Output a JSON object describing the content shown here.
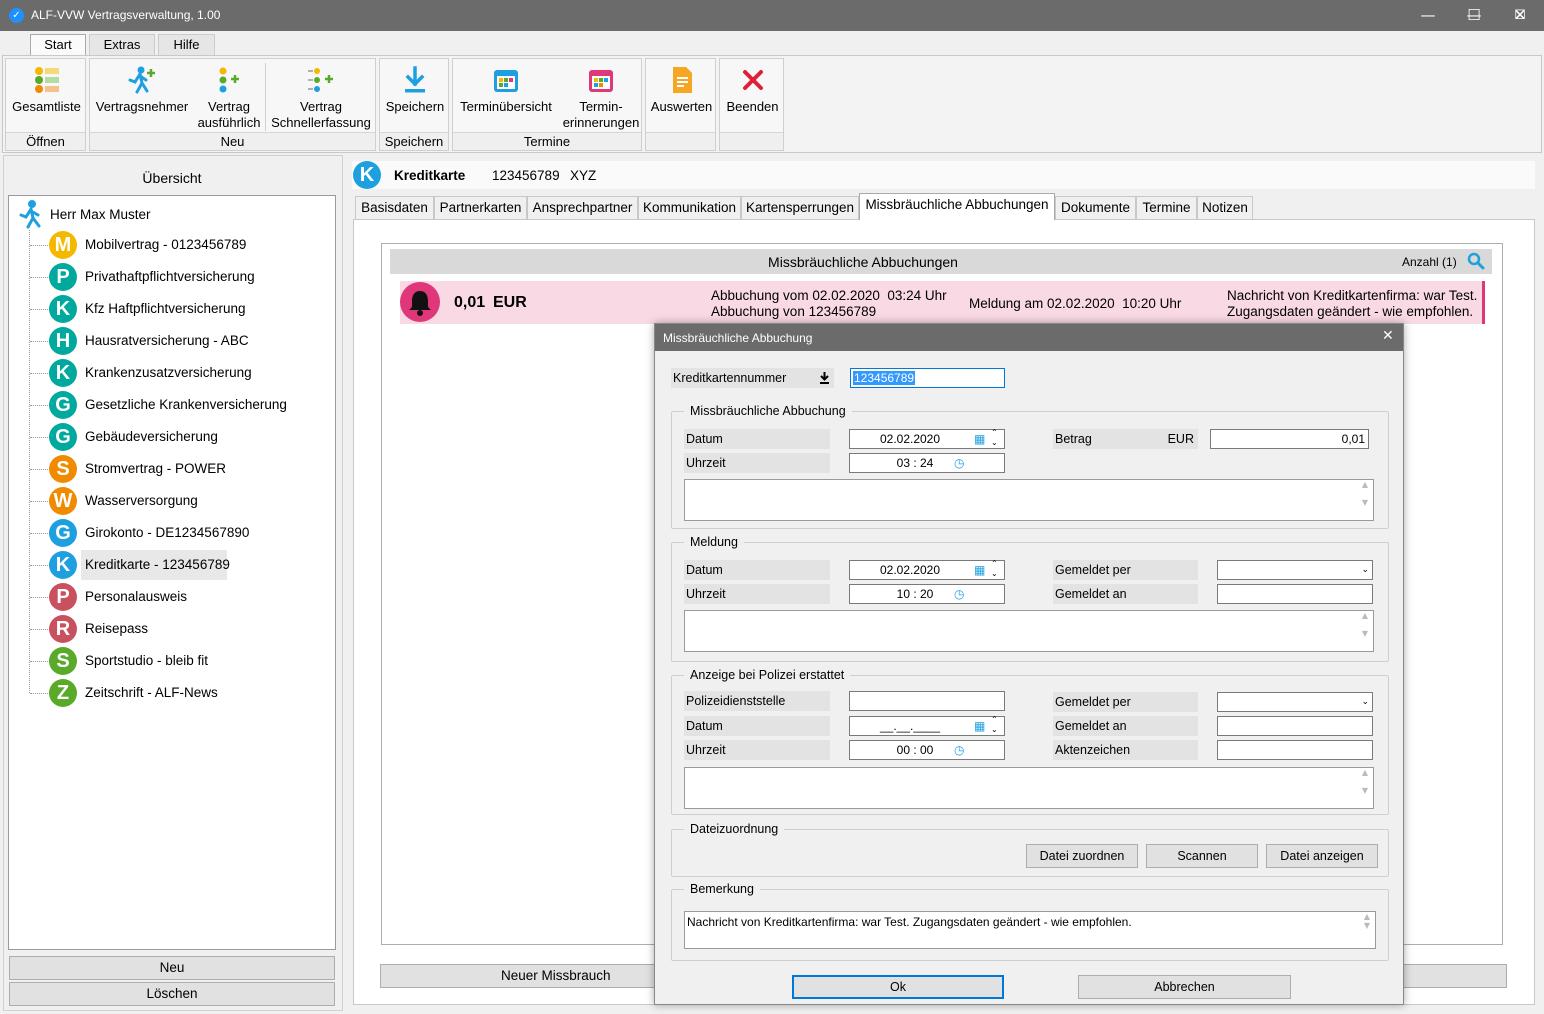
{
  "window": {
    "title": "ALF-VVW Vertragsverwaltung, 1.00",
    "min": "—",
    "max": "☐",
    "close": "✕"
  },
  "menu_tabs": [
    "Start",
    "Extras",
    "Hilfe"
  ],
  "ribbon": {
    "groups": {
      "open": "Öffnen",
      "new": "Neu",
      "save": "Speichern",
      "dates": "Termine"
    },
    "buttons": {
      "gesamtliste": "Gesamtliste",
      "vertragsnehmer": "Vertragsnehmer",
      "vertrag_l1": "Vertrag",
      "vertrag_l2": "ausführlich",
      "schnell_l1": "Vertrag",
      "schnell_l2": "Schnellerfassung",
      "speichern": "Speichern",
      "terminuebersicht": "Terminübersicht",
      "termin_l1": "Termin-",
      "termin_l2": "erinnerungen",
      "auswerten": "Auswerten",
      "beenden": "Beenden"
    }
  },
  "left": {
    "title": "Übersicht",
    "root": "Herr Max Muster",
    "items": [
      {
        "letter": "M",
        "label": "Mobilvertrag - 0123456789",
        "color": "#f5b800"
      },
      {
        "letter": "P",
        "label": "Privathaftpflichtversicherung",
        "color": "#00a99d"
      },
      {
        "letter": "K",
        "label": "Kfz Haftpflichtversicherung",
        "color": "#00a99d"
      },
      {
        "letter": "H",
        "label": "Hausratversicherung - ABC",
        "color": "#00a99d"
      },
      {
        "letter": "K",
        "label": "Krankenzusatzversicherung",
        "color": "#00a99d"
      },
      {
        "letter": "G",
        "label": "Gesetzliche Krankenversicherung",
        "color": "#00a99d"
      },
      {
        "letter": "G",
        "label": "Gebäudeversicherung",
        "color": "#00a99d"
      },
      {
        "letter": "S",
        "label": "Stromvertrag - POWER",
        "color": "#f08a00"
      },
      {
        "letter": "W",
        "label": "Wasserversorgung",
        "color": "#f08a00"
      },
      {
        "letter": "G",
        "label": "Girokonto - DE1234567890",
        "color": "#1ea0e0"
      },
      {
        "letter": "K",
        "label": "Kreditkarte - 123456789",
        "color": "#1ea0e0"
      },
      {
        "letter": "P",
        "label": "Personalausweis",
        "color": "#c9505e"
      },
      {
        "letter": "R",
        "label": "Reisepass",
        "color": "#c9505e"
      },
      {
        "letter": "S",
        "label": "Sportstudio - bleib fit",
        "color": "#5aaa2a"
      },
      {
        "letter": "Z",
        "label": "Zeitschrift - ALF-News",
        "color": "#5aaa2a"
      }
    ],
    "btn_new": "Neu",
    "btn_delete": "Löschen"
  },
  "header": {
    "letter": "K",
    "type": "Kreditkarte",
    "number": "123456789",
    "extra": "XYZ"
  },
  "tabs": [
    "Basisdaten",
    "Partnerkarten",
    "Ansprechpartner",
    "Kommunikation",
    "Kartensperrungen",
    "Missbräuchliche Abbuchungen",
    "Dokumente",
    "Termine",
    "Notizen"
  ],
  "list": {
    "title": "Missbräuchliche Abbuchungen",
    "count": "Anzahl (1)",
    "row": {
      "amount": "0,01",
      "currency": "EUR",
      "line1": "Abbuchung vom 02.02.2020  03:24 Uhr",
      "line2": "Abbuchung von 123456789",
      "report": "Meldung am 02.02.2020  10:20 Uhr",
      "msg1": "Nachricht von Kreditkartenfirma: war Test.",
      "msg2": "Zugangsdaten geändert - wie empfohlen."
    },
    "btn_new": "Neuer Missbrauch"
  },
  "dialog": {
    "title": "Missbräuchliche Abbuchung",
    "card_label": "Kreditkartennummer",
    "card_value": "123456789",
    "g1": {
      "title": "Missbräuchliche Abbuchung",
      "datum_l": "Datum",
      "datum": "02.02.2020",
      "uhrzeit_l": "Uhrzeit",
      "uhrzeit": "03 : 24",
      "betrag_l": "Betrag",
      "currency": "EUR",
      "betrag": "0,01"
    },
    "g2": {
      "title": "Meldung",
      "datum_l": "Datum",
      "datum": "02.02.2020",
      "uhrzeit_l": "Uhrzeit",
      "uhrzeit": "10 : 20",
      "per_l": "Gemeldet per",
      "an_l": "Gemeldet an"
    },
    "g3": {
      "title": "Anzeige bei Polizei erstattet",
      "dienst_l": "Polizeidienststelle",
      "datum_l": "Datum",
      "datum": "__.__.____",
      "uhrzeit_l": "Uhrzeit",
      "uhrzeit": "00 : 00",
      "per_l": "Gemeldet per",
      "an_l": "Gemeldet an",
      "akten_l": "Aktenzeichen"
    },
    "g4": {
      "title": "Dateizuordnung",
      "btn_assign": "Datei zuordnen",
      "btn_scan": "Scannen",
      "btn_show": "Datei anzeigen"
    },
    "g5": {
      "title": "Bemerkung",
      "text": "Nachricht von Kreditkartenfirma: war Test. Zugangsdaten geändert - wie empfohlen."
    },
    "ok": "Ok",
    "cancel": "Abbrechen"
  }
}
